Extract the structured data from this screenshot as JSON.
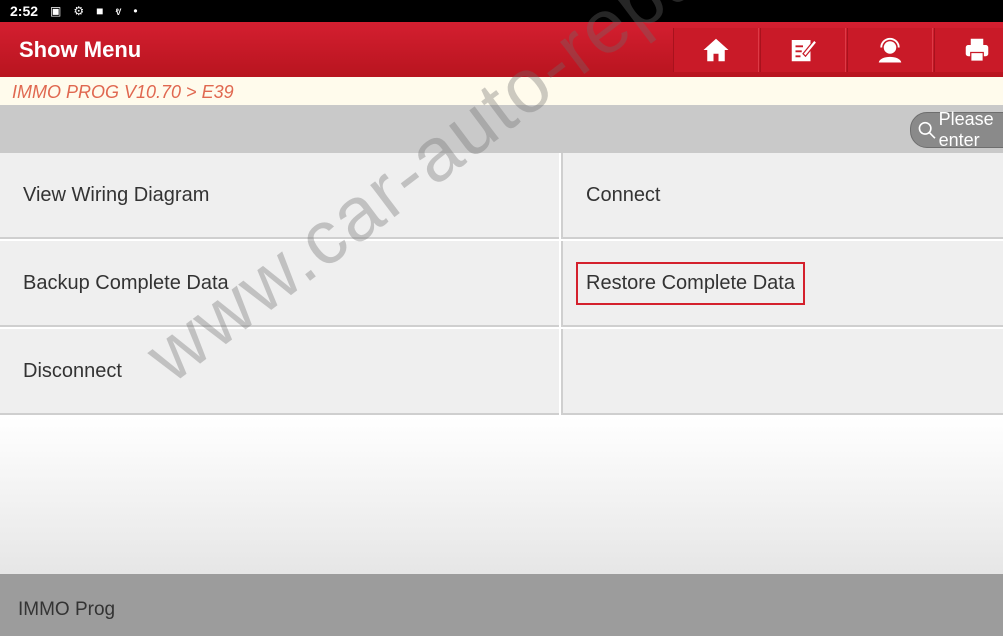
{
  "statusbar": {
    "time": "2:52",
    "icons": [
      "image-icon",
      "gear-icon",
      "camera-icon",
      "stethoscope-icon",
      "dot-icon"
    ]
  },
  "header": {
    "title": "Show Menu",
    "buttons": [
      "home",
      "edit",
      "support",
      "print"
    ]
  },
  "breadcrumb": "IMMO PROG V10.70 > E39",
  "search": {
    "placeholder": "Please enter"
  },
  "menu": [
    {
      "label": "View Wiring Diagram"
    },
    {
      "label": "Connect"
    },
    {
      "label": "Backup Complete Data"
    },
    {
      "label": "Restore Complete Data",
      "highlighted": true
    },
    {
      "label": "Disconnect"
    },
    {
      "label": ""
    }
  ],
  "footer": {
    "label": "IMMO Prog"
  },
  "watermark": "www.car-auto-repair.com",
  "colors": {
    "header": "#c91a28",
    "breadcrumb_text": "#e06850",
    "highlight": "#d4202c"
  }
}
